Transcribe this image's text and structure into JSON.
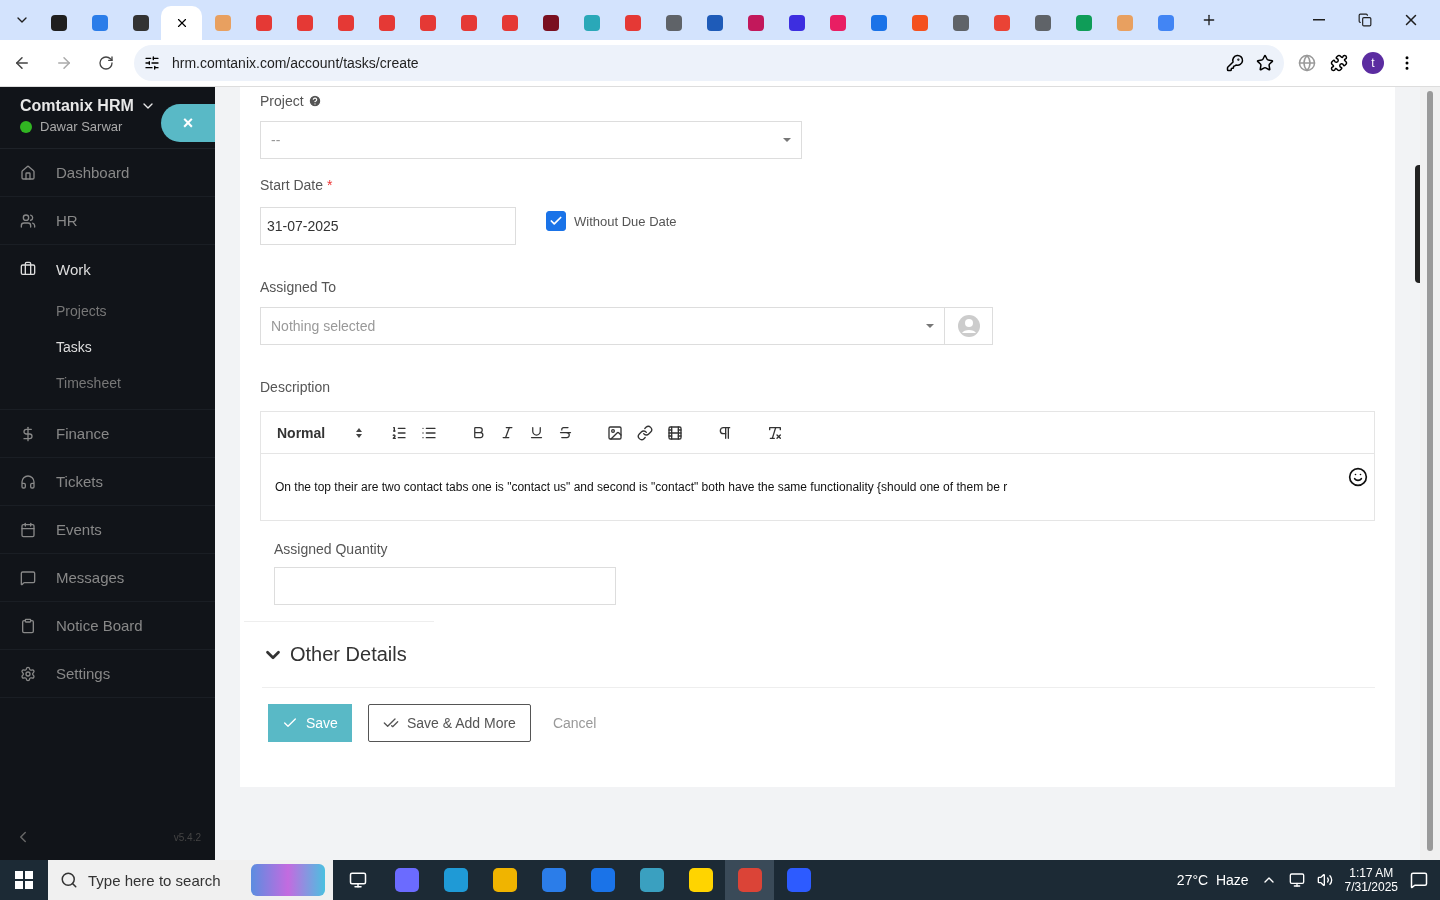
{
  "browser": {
    "tabs": [
      {
        "color": "#1f1f1f",
        "selected": false
      },
      {
        "color": "#2b7de9",
        "selected": false
      },
      {
        "color": "#333333",
        "selected": false
      },
      {
        "selected": true
      },
      {
        "color": "#e8a060",
        "selected": false
      },
      {
        "color": "#e53935",
        "selected": false
      },
      {
        "color": "#e53935",
        "selected": false
      },
      {
        "color": "#e53935",
        "selected": false
      },
      {
        "color": "#e53935",
        "selected": false
      },
      {
        "color": "#e53935",
        "selected": false
      },
      {
        "color": "#e53935",
        "selected": false
      },
      {
        "color": "#e53935",
        "selected": false
      },
      {
        "color": "#7a1020",
        "selected": false
      },
      {
        "color": "#2aa8b8",
        "selected": false
      },
      {
        "color": "#e53935",
        "selected": false
      },
      {
        "color": "#5f6368",
        "selected": false
      },
      {
        "color": "#1e5bb8",
        "selected": false
      },
      {
        "color": "#c2185b",
        "selected": false
      },
      {
        "color": "#3d2ee0",
        "selected": false
      },
      {
        "color": "#e91e63",
        "selected": false
      },
      {
        "color": "#1a73e8",
        "selected": false
      },
      {
        "color": "#f4511e",
        "selected": false
      },
      {
        "color": "#5f6368",
        "selected": false
      },
      {
        "color": "#ea4335",
        "selected": false
      },
      {
        "color": "#5f6368",
        "selected": false
      },
      {
        "color": "#0f9d58",
        "selected": false
      },
      {
        "color": "#e8a060",
        "selected": false
      },
      {
        "color": "#4285f4",
        "selected": false
      }
    ],
    "url": "hrm.comtanix.com/account/tasks/create",
    "profile": "t"
  },
  "sidebar": {
    "app_name": "Comtanix HRM",
    "user": "Dawar Sarwar",
    "online": true,
    "close_label": "×",
    "items": [
      {
        "label": "Dashboard",
        "selected": false
      },
      {
        "label": "HR",
        "selected": false
      },
      {
        "label": "Work",
        "selected": true,
        "children": [
          {
            "label": "Projects",
            "selected": false
          },
          {
            "label": "Tasks",
            "selected": true
          },
          {
            "label": "Timesheet",
            "selected": false
          }
        ]
      },
      {
        "label": "Finance",
        "selected": false
      },
      {
        "label": "Tickets",
        "selected": false
      },
      {
        "label": "Events",
        "selected": false
      },
      {
        "label": "Messages",
        "selected": false
      },
      {
        "label": "Notice Board",
        "selected": false
      },
      {
        "label": "Settings",
        "selected": false
      }
    ],
    "version": "v5.4.2"
  },
  "form": {
    "project": {
      "label": "Project",
      "value": "--"
    },
    "start_date": {
      "label": "Start Date",
      "required_mark": "*",
      "value": "31-07-2025"
    },
    "without_due_date": {
      "label": "Without Due Date",
      "checked": true
    },
    "assigned_to": {
      "label": "Assigned To",
      "placeholder": "Nothing selected"
    },
    "description": {
      "label": "Description",
      "format": "Normal",
      "text": "On the top their are two contact tabs one is \"contact us\" and second is \"contact\" both have the same functionality {should one of them be r"
    },
    "assigned_quantity": {
      "label": "Assigned Quantity"
    },
    "other_details": {
      "label": "Other Details"
    },
    "buttons": {
      "save": "Save",
      "save_add": "Save & Add More",
      "cancel": "Cancel"
    }
  },
  "taskbar": {
    "search_placeholder": "Type here to search",
    "weather": "27°C  Haze",
    "time": "1:17 AM",
    "date": "7/31/2025"
  }
}
